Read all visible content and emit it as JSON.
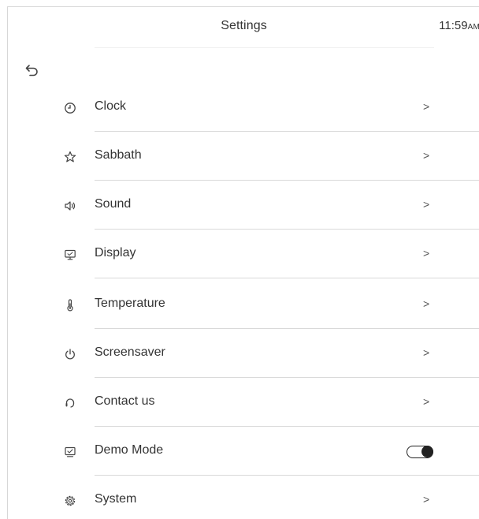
{
  "header": {
    "title": "Settings",
    "time": "11:59",
    "ampm": "AM"
  },
  "back": {
    "icon": "back-arrow-icon"
  },
  "menu": {
    "items": [
      {
        "label": "Clock",
        "icon": "clock-icon",
        "chevron": ">"
      },
      {
        "label": "Sabbath",
        "icon": "star-icon",
        "chevron": ">"
      },
      {
        "label": "Sound",
        "icon": "speaker-icon",
        "chevron": ">"
      },
      {
        "label": "Display",
        "icon": "monitor-icon",
        "chevron": ">"
      },
      {
        "label": "Temperature",
        "icon": "thermometer-icon",
        "chevron": ">"
      },
      {
        "label": "Screensaver",
        "icon": "power-icon",
        "chevron": ">"
      },
      {
        "label": "Contact us",
        "icon": "headset-icon",
        "chevron": ">"
      },
      {
        "label": "Demo Mode",
        "icon": "demo-mode-icon",
        "toggle_on": true
      },
      {
        "label": "System",
        "icon": "gear-icon",
        "chevron": ">"
      }
    ]
  },
  "colors": {
    "text": "#333333",
    "divider": "#d9d9d9",
    "toggle": "#222222"
  }
}
